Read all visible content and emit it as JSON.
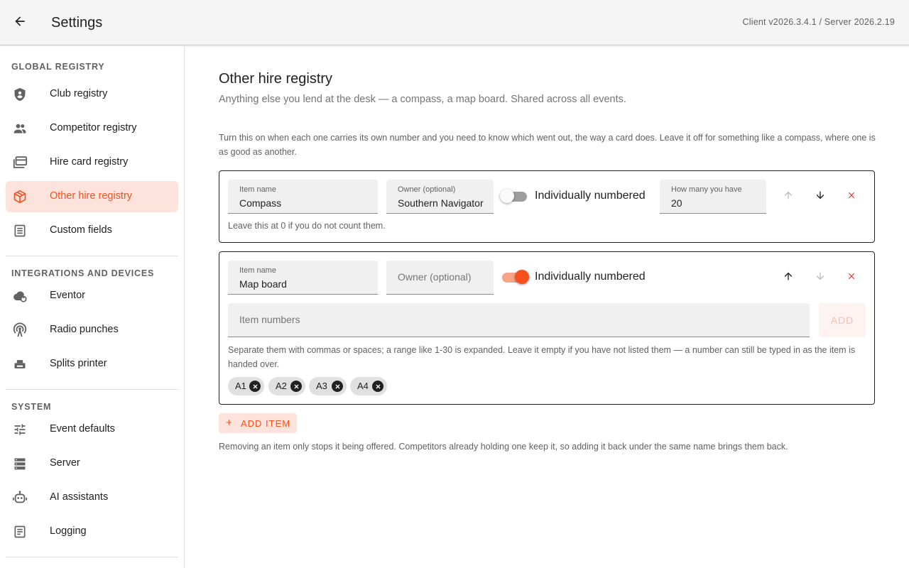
{
  "header": {
    "title": "Settings",
    "version": "Client v2026.3.4.1 / Server 2026.2.19",
    "back_icon": "arrow-back-icon"
  },
  "sidebar": {
    "sections": [
      {
        "title": "GLOBAL REGISTRY"
      },
      {
        "title": "INTEGRATIONS AND DEVICES"
      },
      {
        "title": "SYSTEM"
      }
    ],
    "items": [
      {
        "label": "Club registry",
        "icon": "shield-account-icon",
        "active": false
      },
      {
        "label": "Competitor registry",
        "icon": "people-icon",
        "active": false
      },
      {
        "label": "Hire card registry",
        "icon": "cards-icon",
        "active": false
      },
      {
        "label": "Other hire registry",
        "icon": "package-icon",
        "active": true
      },
      {
        "label": "Custom fields",
        "icon": "form-icon",
        "active": false
      },
      {
        "label": "Eventor",
        "icon": "cloud-sync-icon",
        "active": false
      },
      {
        "label": "Radio punches",
        "icon": "radio-tower-icon",
        "active": false
      },
      {
        "label": "Splits printer",
        "icon": "printer-icon",
        "active": false
      },
      {
        "label": "Event defaults",
        "icon": "tune-icon",
        "active": false
      },
      {
        "label": "Server",
        "icon": "server-icon",
        "active": false
      },
      {
        "label": "AI assistants",
        "icon": "robot-icon",
        "active": false
      },
      {
        "label": "Logging",
        "icon": "log-icon",
        "active": false
      }
    ]
  },
  "main": {
    "title": "Other hire registry",
    "subtitle": "Anything else you lend at the desk — a compass, a map board. Shared across all events.",
    "help": "Turn this on when each one carries its own number and you need to know which went out, the way a card does. Leave it off for something like a compass, where one is as good as another.",
    "items": [
      {
        "name_label": "Item name",
        "name": "Compass",
        "owner_label": "Owner (optional)",
        "owner": "Southern Navigator",
        "numbered_label": "Individually numbered",
        "numbered": false,
        "count_label": "How many you have",
        "count": "20",
        "hint": "Leave this at 0 if you do not count them."
      },
      {
        "name_label": "Item name",
        "name": "Map board",
        "owner_placeholder": "Owner (optional)",
        "numbered_label": "Individually numbered",
        "numbered": true,
        "numbers_placeholder": "Item numbers",
        "add_label": "ADD",
        "hint": "Separate them with commas or spaces; a range like 1-30 is expanded. Leave it empty if you have not listed them — a number can still be typed in as the item is handed over.",
        "chips": [
          "A1",
          "A2",
          "A3",
          "A4"
        ]
      }
    ],
    "add_item_label": "ADD ITEM",
    "footer_note": "Removing an item only stops it being offered. Competitors already holding one keep it, so adding it back under the same name brings them back."
  },
  "colors": {
    "accent": "#f4511e",
    "accent_light": "#fde3dc",
    "delete": "#e53935"
  }
}
